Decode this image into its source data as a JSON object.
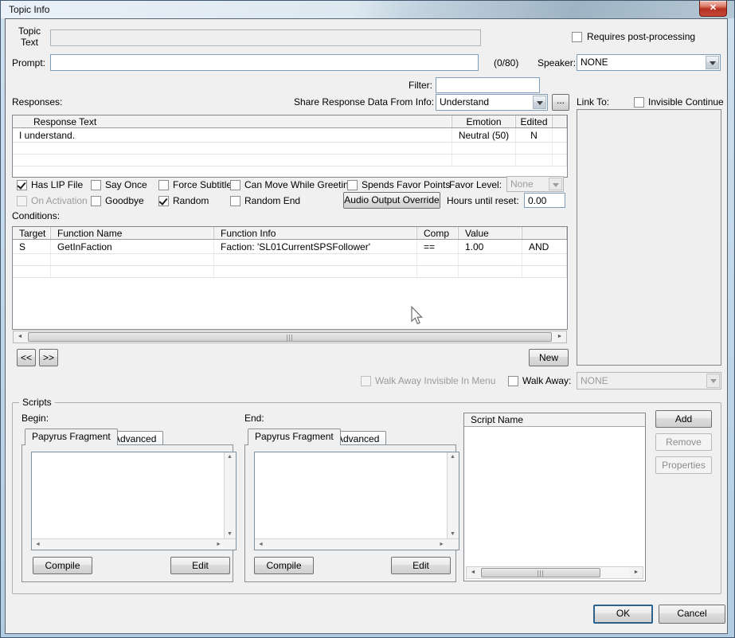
{
  "window": {
    "title": "Topic Info",
    "close_glyph": "✕",
    "frame_color": "#b2cde2",
    "close_color": "#c23b2e"
  },
  "topic": {
    "label": "Topic Text",
    "value": ""
  },
  "post_processing": {
    "label": "Requires post-processing",
    "checked": false
  },
  "prompt": {
    "label": "Prompt:",
    "value": "",
    "counter": "(0/80)"
  },
  "speaker": {
    "label": "Speaker:",
    "value": "NONE"
  },
  "filter": {
    "label": "Filter:",
    "value": ""
  },
  "responses": {
    "label": "Responses:"
  },
  "share_response": {
    "label": "Share Response Data From Info:",
    "value": "Understand",
    "more_button": "..."
  },
  "link_to": {
    "label": "Link To:"
  },
  "invisible_continue": {
    "label": "Invisible Continue",
    "checked": false
  },
  "response_table": {
    "headers": {
      "text": "Response Text",
      "emotion": "Emotion",
      "edited": "Edited"
    },
    "rows": [
      {
        "text": "I understand.",
        "emotion": "Neutral (50)",
        "edited": "N"
      }
    ]
  },
  "flags": {
    "has_lip": {
      "label": "Has LIP File",
      "checked": true
    },
    "say_once": {
      "label": "Say Once",
      "checked": false
    },
    "force_subtitle": {
      "label": "Force Subtitle",
      "checked": false
    },
    "can_move": {
      "label": "Can Move While Greeting",
      "checked": false
    },
    "spends_favor": {
      "label": "Spends Favor Points",
      "checked": false
    },
    "on_activation": {
      "label": "On Activation",
      "checked": false
    },
    "goodbye": {
      "label": "Goodbye",
      "checked": false
    },
    "random": {
      "label": "Random",
      "checked": true
    },
    "random_end": {
      "label": "Random End",
      "checked": false
    }
  },
  "favor_level": {
    "label": "Favor Level:",
    "value": "None"
  },
  "audio_override": {
    "label": "Audio Output Override"
  },
  "hours_reset": {
    "label": "Hours until reset:",
    "value": "0.00"
  },
  "conditions": {
    "label": "Conditions:",
    "headers": {
      "target": "Target",
      "function_name": "Function Name",
      "function_info": "Function Info",
      "comp": "Comp",
      "value": "Value"
    },
    "rows": [
      {
        "target": "S",
        "function_name": "GetInFaction",
        "function_info": "Faction: 'SL01CurrentSPSFollower'",
        "comp": "==",
        "value": "1.00",
        "operator": "AND"
      }
    ]
  },
  "nav": {
    "prev": "<<",
    "next": ">>",
    "new_button": "New"
  },
  "walk_away_invisible": {
    "label": "Walk Away Invisible In Menu",
    "checked": false
  },
  "walk_away": {
    "label": "Walk Away:",
    "checked": false,
    "value": "NONE"
  },
  "scripts": {
    "group_label": "Scripts",
    "begin_label": "Begin:",
    "end_label": "End:",
    "tab_fragment": "Papyrus Fragment",
    "tab_advanced": "Advanced",
    "compile": "Compile",
    "edit": "Edit",
    "list_header": "Script Name",
    "add": "Add",
    "remove": "Remove",
    "properties": "Properties"
  },
  "footer": {
    "ok": "OK",
    "cancel": "Cancel"
  }
}
